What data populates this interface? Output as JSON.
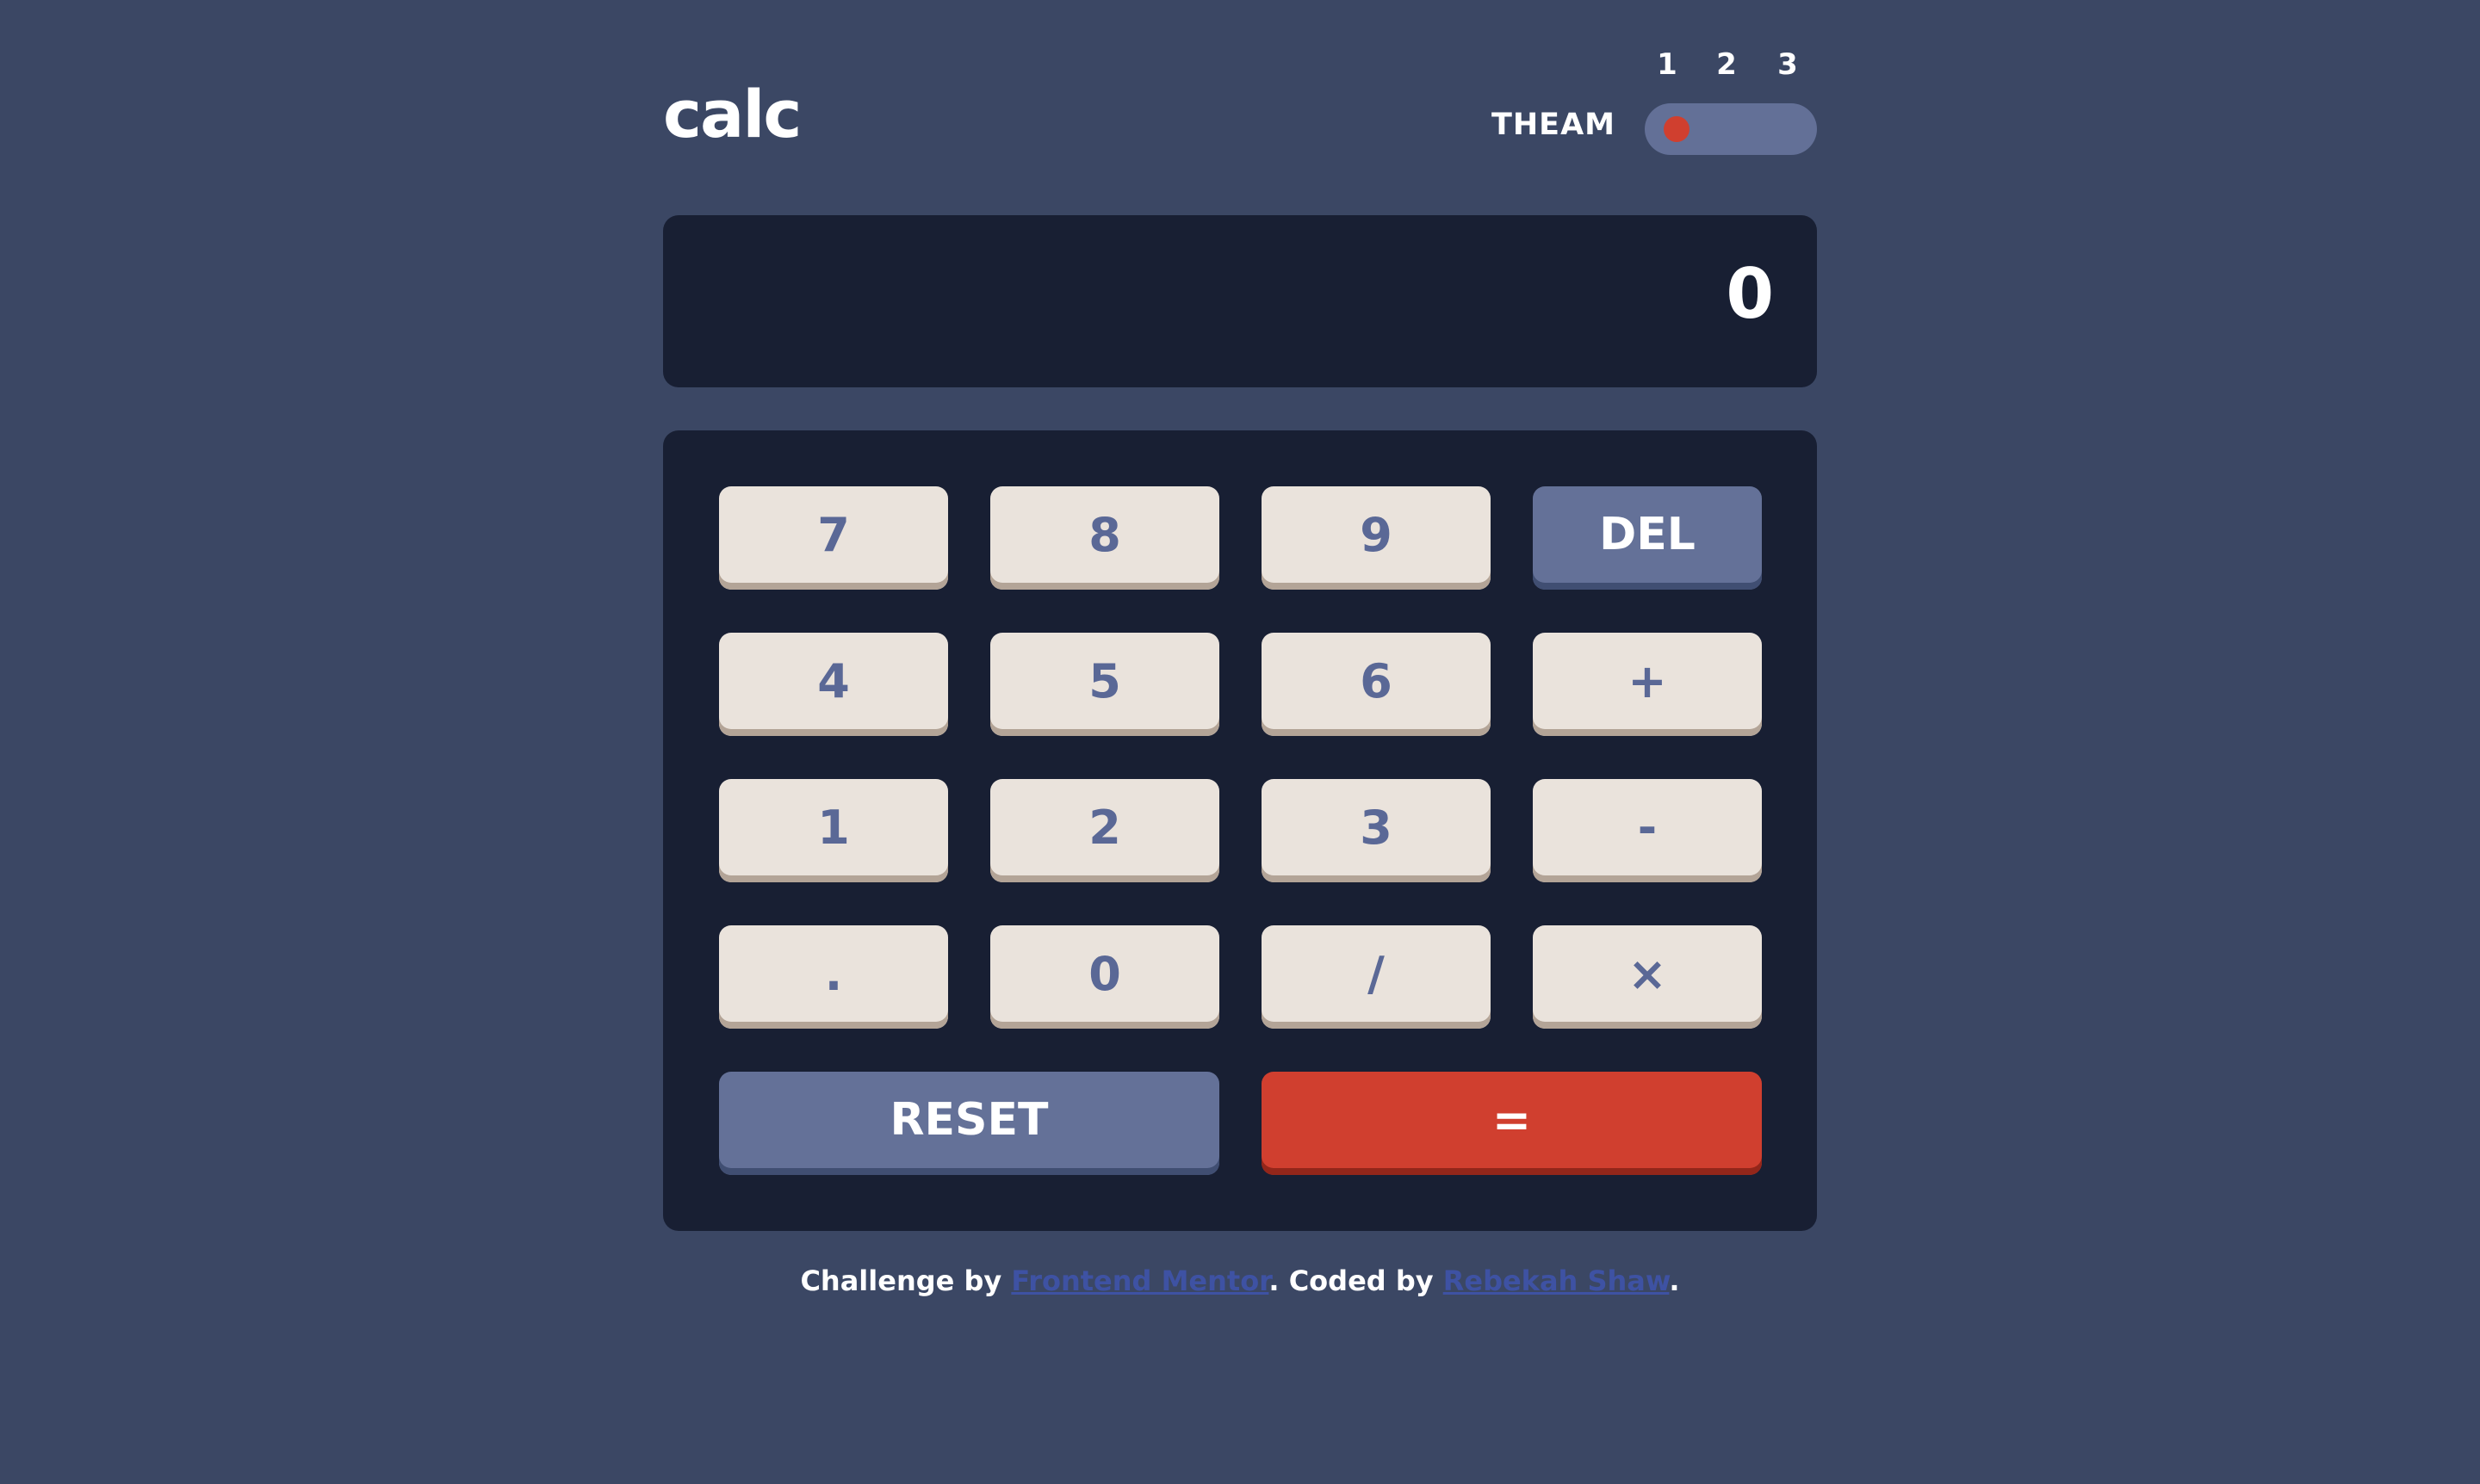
{
  "header": {
    "logo": "calc",
    "theme_label": "THEAM",
    "theme_numbers": [
      "1",
      "2",
      "3"
    ],
    "selected_theme": 1
  },
  "screen": {
    "value": "0"
  },
  "keys": {
    "seven": "7",
    "eight": "8",
    "nine": "9",
    "del": "DEL",
    "four": "4",
    "five": "5",
    "six": "6",
    "plus": "+",
    "one": "1",
    "two": "2",
    "three": "3",
    "minus": "-",
    "dot": ".",
    "zero": "0",
    "divide": "/",
    "multiply": "×",
    "reset": "RESET",
    "equals": "="
  },
  "footer": {
    "prefix": "Challenge by ",
    "link1": "Frontend Mentor",
    "middle": ". Coded by ",
    "link2": "Rebekah Shaw",
    "suffix": "."
  },
  "colors": {
    "background": "#3b4764",
    "screen": "#181f33",
    "key": "#eae3dc",
    "key_text": "#5a6896",
    "accent_blue": "#647198",
    "accent_red": "#d03f2f"
  }
}
